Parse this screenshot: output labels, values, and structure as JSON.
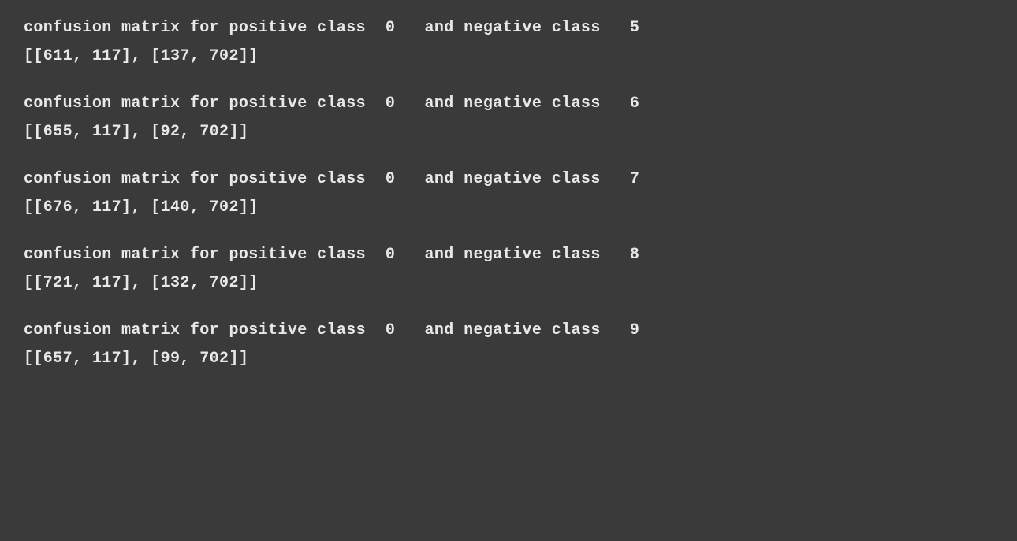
{
  "entries": [
    {
      "header": "confusion matrix for positive class  0   and negative class   5",
      "matrix": "[[611, 117], [137, 702]]"
    },
    {
      "header": "confusion matrix for positive class  0   and negative class   6",
      "matrix": "[[655, 117], [92, 702]]"
    },
    {
      "header": "confusion matrix for positive class  0   and negative class   7",
      "matrix": "[[676, 117], [140, 702]]"
    },
    {
      "header": "confusion matrix for positive class  0   and negative class   8",
      "matrix": "[[721, 117], [132, 702]]"
    },
    {
      "header": "confusion matrix for positive class  0   and negative class   9",
      "matrix": "[[657, 117], [99, 702]]"
    }
  ]
}
